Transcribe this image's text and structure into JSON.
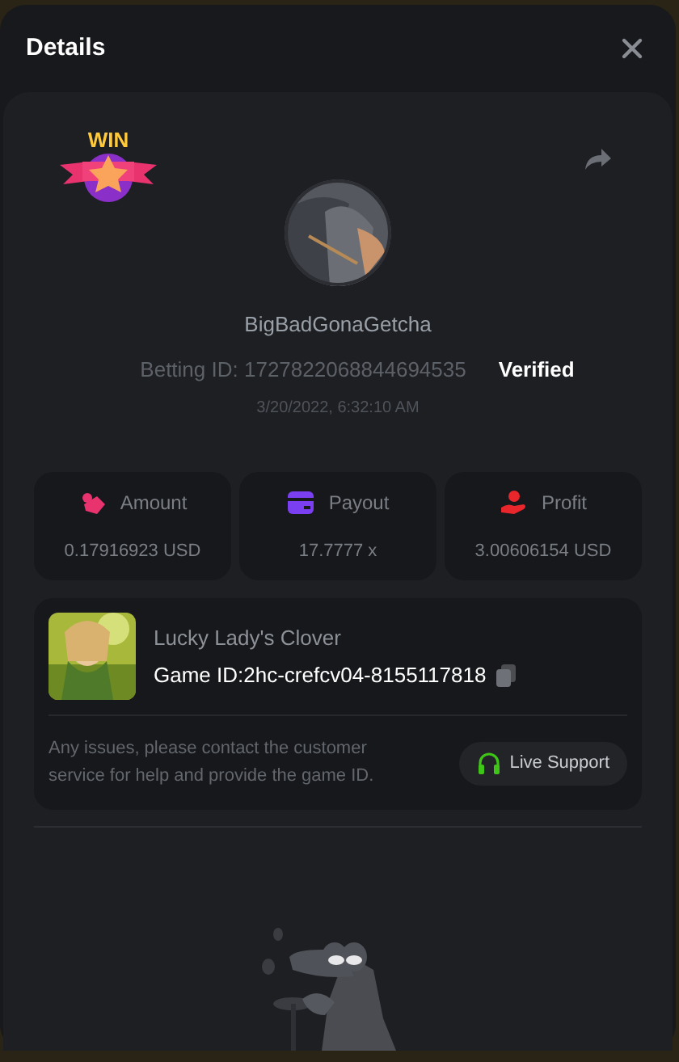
{
  "dialog": {
    "title": "Details"
  },
  "badge": {
    "label": "WIN"
  },
  "player": {
    "name": "BigBadGonaGetcha",
    "betting_id": "Betting ID: 1727822068844694535",
    "verified_label": "Verified",
    "verified": true,
    "time": "3/20/2022, 6:32:10 AM"
  },
  "stats": [
    {
      "kind": "amount",
      "label": "Amount",
      "value": "0.17916923 USD",
      "color": "#e8336f"
    },
    {
      "kind": "payout",
      "label": "Payout",
      "value": "17.7777 x",
      "color": "#7b3ff2"
    },
    {
      "kind": "profit",
      "label": "Profit",
      "value": "3.00606154 USD",
      "color": "#e8262b"
    }
  ],
  "game": {
    "name": "Lucky Lady's Clover",
    "id_label": "Game ID:",
    "id": "2hc-crefcv04-8155117818",
    "note": "Any issues, please contact the customer service for help and provide the game ID.",
    "support_button": "Live Support"
  }
}
